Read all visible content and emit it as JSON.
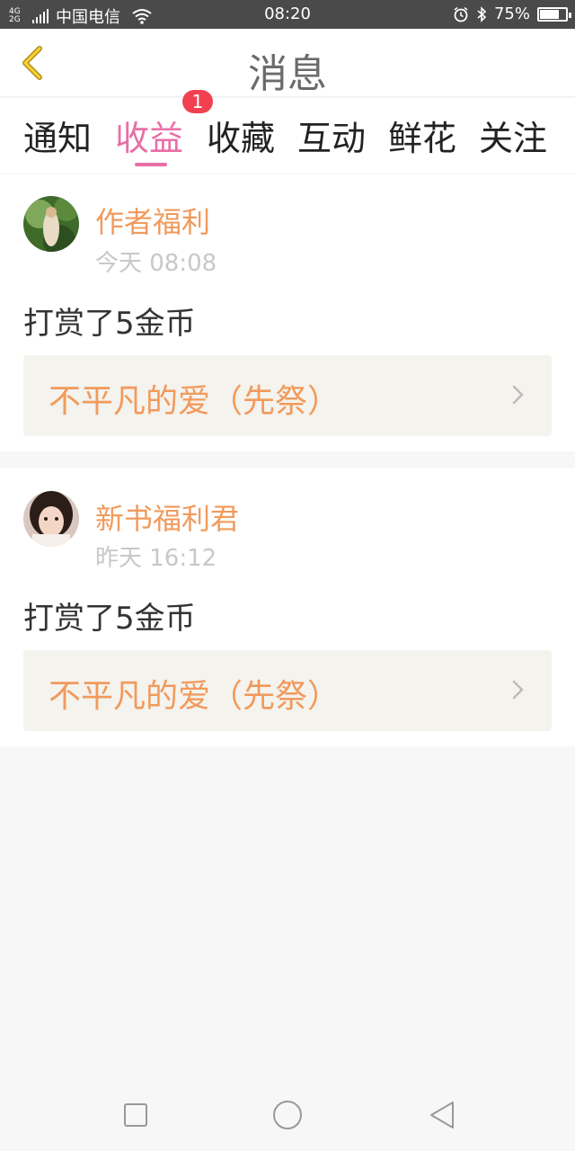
{
  "status_bar": {
    "network_type": "4G 2G",
    "carrier": "中国电信",
    "time": "08:20",
    "battery": "75%",
    "battery_level": 0.75,
    "icons": [
      "signal-icon",
      "wifi-icon",
      "alarm-icon",
      "bluetooth-icon",
      "battery-icon"
    ]
  },
  "header": {
    "title": "消息",
    "back_icon": "chevron-left-icon"
  },
  "tabs": {
    "items": [
      {
        "label": "通知"
      },
      {
        "label": "收益"
      },
      {
        "label": "收藏"
      },
      {
        "label": "互动"
      },
      {
        "label": "鲜花"
      },
      {
        "label": "关注"
      }
    ],
    "active": "收益",
    "badge": "1"
  },
  "messages": [
    {
      "author": "作者福利",
      "time": "今天 08:08",
      "text": "打赏了5金币",
      "book": "不平凡的爱（先祭）"
    },
    {
      "author": "新书福利君",
      "time": "昨天 16:12",
      "text": "打赏了5金币",
      "book": "不平凡的爱（先祭）"
    }
  ],
  "colors": {
    "accent": "#e86fa6",
    "author": "#f19a5c",
    "badge": "#f14150",
    "status_bar": "#4a4a4a"
  },
  "nav_icons": [
    "recent-apps-icon",
    "home-icon",
    "back-icon"
  ]
}
